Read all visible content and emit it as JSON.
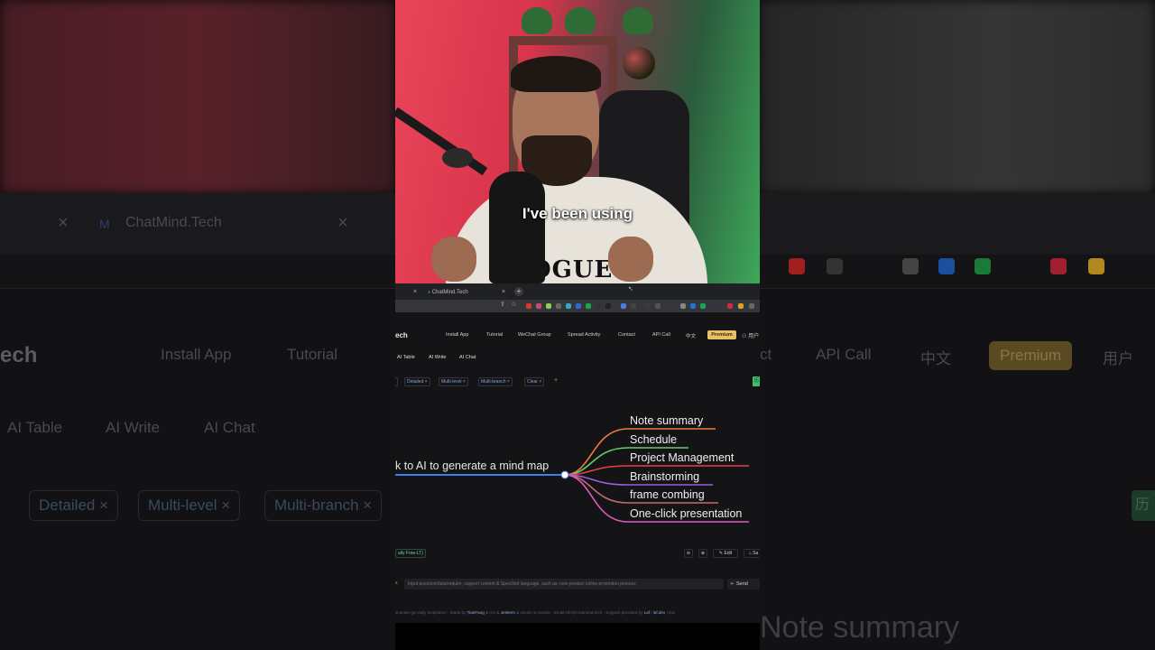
{
  "video": {
    "caption": "I've been using",
    "shirt_print": "OGUE"
  },
  "browser": {
    "tabs": [
      {
        "title": "ChatMind.Tech",
        "close": "×"
      }
    ],
    "left_tab_close": "×",
    "new_tab": "+"
  },
  "app": {
    "brand": "ech",
    "nav": [
      "Install App",
      "Tutorial",
      "WeChat Group",
      "Spread Activity",
      "Contact",
      "API Call",
      "中文"
    ],
    "premium_label": "Premium",
    "user_label": "用户",
    "subtabs": [
      "AI Table",
      "AI Write",
      "AI Chat"
    ],
    "chips": [
      "Detailed",
      "Multi-level",
      "Multi-branch",
      "Clear"
    ],
    "chip_add": "+",
    "green_tag": "历"
  },
  "mindmap": {
    "root": "k to AI to generate a mind map",
    "branches": [
      {
        "label": "Note summary",
        "color": "#f07a3c"
      },
      {
        "label": "Schedule",
        "color": "#5fd068"
      },
      {
        "label": "Project Management",
        "color": "#e8404a"
      },
      {
        "label": "Brainstorming",
        "color": "#9a5fe0"
      },
      {
        "label": "frame combing",
        "color": "#c26d6d"
      },
      {
        "label": "One-click presentation",
        "color": "#e45bc0"
      }
    ],
    "root_color": "#3f7ee8"
  },
  "controls": {
    "daily_label": "aily Free-LT)",
    "zoom_out": "⊖",
    "zoom_in": "⊕",
    "edit_label": "Edit",
    "save_label": "Sa"
  },
  "input": {
    "prefix": "s",
    "placeholder": "Input question/data/require, support content & Specified language, such as: new product online promotion process",
    "send_label": "Send"
  },
  "footer": {
    "text_a": "scanate get daily inspiration · Made by ",
    "tianfang": "TianFang",
    "amp1": " & Am & ",
    "jeekers": "Jeekers",
    "amp2": " & Jevein & Acwink · Email:info@chatmind.tech · Support provided by ",
    "laf": "Laf",
    "laf_dev": "laf.dev",
    "rest": " | Kai"
  },
  "background_blur": {
    "left_brand": "ech",
    "left_nav": [
      "Install App",
      "Tutorial"
    ],
    "left_subtabs": [
      "AI Table",
      "AI Write",
      "AI Chat"
    ],
    "left_chips": [
      "Detailed",
      "Multi-level",
      "Multi-branch"
    ],
    "right_nav": [
      "ct",
      "API Call",
      "中文"
    ],
    "right_premium": "Premium",
    "right_user": "用户",
    "tab_title": "ChatMind.Tech",
    "note": "Note summary",
    "green_tag": "历"
  }
}
